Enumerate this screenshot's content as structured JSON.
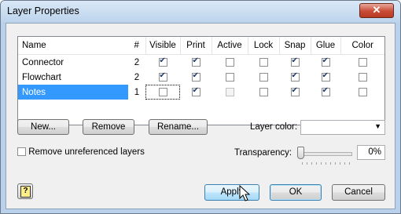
{
  "window": {
    "title": "Layer Properties",
    "close_glyph": "✕"
  },
  "table": {
    "columns": [
      "Name",
      "#",
      "Visible",
      "Print",
      "Active",
      "Lock",
      "Snap",
      "Glue",
      "Color"
    ],
    "rows": [
      {
        "name": "Connector",
        "num": "2",
        "visible": true,
        "print": true,
        "active": false,
        "lock": false,
        "snap": true,
        "glue": true,
        "color": false,
        "selected": false
      },
      {
        "name": "Flowchart",
        "num": "2",
        "visible": true,
        "print": true,
        "active": false,
        "lock": false,
        "snap": true,
        "glue": true,
        "color": false,
        "selected": false
      },
      {
        "name": "Notes",
        "num": "1",
        "visible": false,
        "print": true,
        "active": false,
        "lock": false,
        "snap": true,
        "glue": true,
        "color": false,
        "selected": true
      }
    ]
  },
  "buttons": {
    "new": "New...",
    "remove": "Remove",
    "rename": "Rename...",
    "apply": "Apply",
    "ok": "OK",
    "cancel": "Cancel"
  },
  "layer_color": {
    "label": "Layer color:",
    "value": ""
  },
  "remove_unreferenced": {
    "label": "Remove unreferenced layers",
    "checked": false
  },
  "transparency": {
    "label": "Transparency:",
    "value": "0%",
    "level": 0
  },
  "help": {
    "glyph": "?"
  }
}
